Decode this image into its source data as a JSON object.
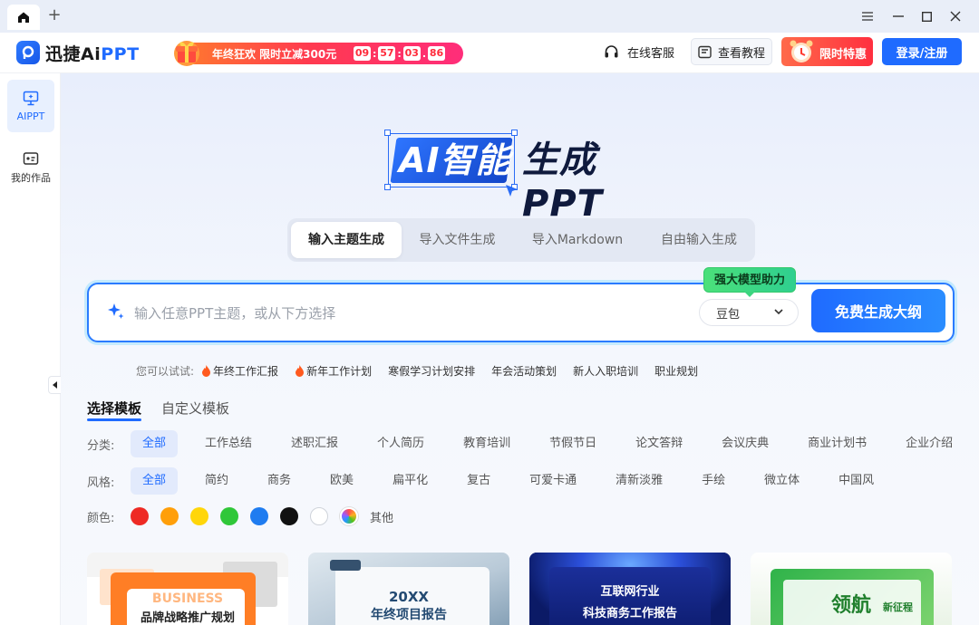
{
  "titlebar": {
    "home_icon": "home-icon",
    "new_tab_label": "+"
  },
  "header": {
    "logo_text_1": "迅捷Ai",
    "logo_text_2": "PPT",
    "promo_text": "年终狂欢 限时立减300元",
    "promo_timer": [
      "09",
      "57",
      "03",
      "86"
    ],
    "support_label": "在线客服",
    "tutorial_label": "查看教程",
    "limited_label": "限时特惠",
    "login_label": "登录/注册"
  },
  "sidebar": {
    "items": [
      {
        "label": "AIPPT",
        "icon": "monitor-icon"
      },
      {
        "label": "我的作品",
        "icon": "works-icon"
      }
    ]
  },
  "hero": {
    "ai_text": "AI智能",
    "rest_text": "生成PPT"
  },
  "mode_tabs": [
    "输入主题生成",
    "导入文件生成",
    "导入Markdown",
    "自由输入生成"
  ],
  "input": {
    "placeholder": "输入任意PPT主题，或从下方选择",
    "model_tip": "强大模型助力",
    "model_value": "豆包",
    "generate_label": "免费生成大纲"
  },
  "suggestions": {
    "label": "您可以试试:",
    "items": [
      {
        "text": "年终工作汇报",
        "hot": true
      },
      {
        "text": "新年工作计划",
        "hot": true
      },
      {
        "text": "寒假学习计划安排",
        "hot": false
      },
      {
        "text": "年会活动策划",
        "hot": false
      },
      {
        "text": "新人入职培训",
        "hot": false
      },
      {
        "text": "职业规划",
        "hot": false
      }
    ]
  },
  "template_tabs": [
    "选择模板",
    "自定义模板"
  ],
  "filters": {
    "category": {
      "label": "分类:",
      "options": [
        "全部",
        "工作总结",
        "述职汇报",
        "个人简历",
        "教育培训",
        "节假节日",
        "论文答辩",
        "会议庆典",
        "商业计划书",
        "企业介绍"
      ]
    },
    "style": {
      "label": "风格:",
      "options": [
        "全部",
        "简约",
        "商务",
        "欧美",
        "扁平化",
        "复古",
        "可爱卡通",
        "清新淡雅",
        "手绘",
        "微立体",
        "中国风"
      ]
    },
    "color": {
      "label": "颜色:",
      "swatches": [
        "#ee2a24",
        "#ff9f0a",
        "#ffd60a",
        "#30c739",
        "#1f7cf0",
        "#111111",
        "#ffffff"
      ],
      "other_label": "其他"
    }
  },
  "cards": [
    {
      "big": "BUSINESS",
      "title": "品牌战略推广规划"
    },
    {
      "big": "20XX",
      "title": "年终项目报告"
    },
    {
      "big": "互联网行业",
      "title": "科技商务工作报告"
    },
    {
      "big": "领航",
      "title": "新征程"
    }
  ]
}
